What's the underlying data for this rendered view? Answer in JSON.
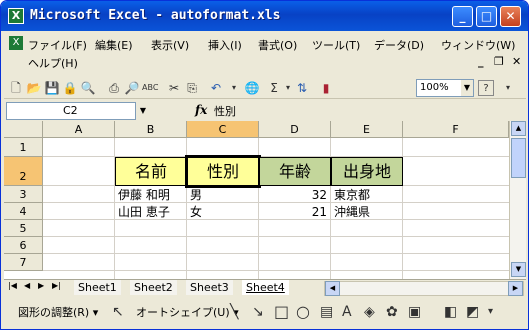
{
  "window": {
    "title": "Microsoft Excel - autoformat.xls",
    "app_icon": "X",
    "min_label": "_",
    "max_label": "□",
    "close_label": "✕"
  },
  "menu": {
    "items": [
      "ファイル(F)",
      "編集(E)",
      "表示(V)",
      "挿入(I)",
      "書式(O)",
      "ツール(T)",
      "データ(D)",
      "ウィンドウ(W)"
    ],
    "help": "ヘルプ(H)",
    "mdi": {
      "min": "_",
      "restore": "❐",
      "close": "✕"
    }
  },
  "toolbar": {
    "zoom": "100%",
    "icons": [
      "new-icon",
      "open-icon",
      "save-icon",
      "permission-icon",
      "research-icon",
      "print-icon",
      "preview-icon",
      "spelling-icon",
      "cut-icon",
      "copy-icon",
      "undo-icon",
      "hyperlink-icon",
      "autosum-icon",
      "sort-icon",
      "chart-icon",
      "help-icon"
    ]
  },
  "formula_bar": {
    "name_box": "C2",
    "fx": "fx",
    "value": "性別"
  },
  "sheet": {
    "columns": [
      "A",
      "B",
      "C",
      "D",
      "E",
      "F"
    ],
    "rows": [
      "1",
      "2",
      "3",
      "4",
      "5",
      "6",
      "7"
    ],
    "header_cells": [
      {
        "text": "名前",
        "color": "#ffff99"
      },
      {
        "text": "性別",
        "color": "#ffff99"
      },
      {
        "text": "年齢",
        "color": "#c3d69b"
      },
      {
        "text": "出身地",
        "color": "#c3d69b"
      }
    ],
    "data": [
      [
        "伊藤 和明",
        "男",
        "32",
        "東京都"
      ],
      [
        "山田 恵子",
        "女",
        "21",
        "沖縄県"
      ]
    ]
  },
  "tabs": {
    "nav": [
      "|◀",
      "◀",
      "▶",
      "▶|"
    ],
    "sheets": [
      "Sheet1",
      "Sheet2",
      "Sheet3",
      "Sheet4"
    ],
    "active": "Sheet4"
  },
  "drawing": {
    "adjust": "図形の調整(R) ▾",
    "autoshapes": "オートシェイプ(U) ▾"
  }
}
